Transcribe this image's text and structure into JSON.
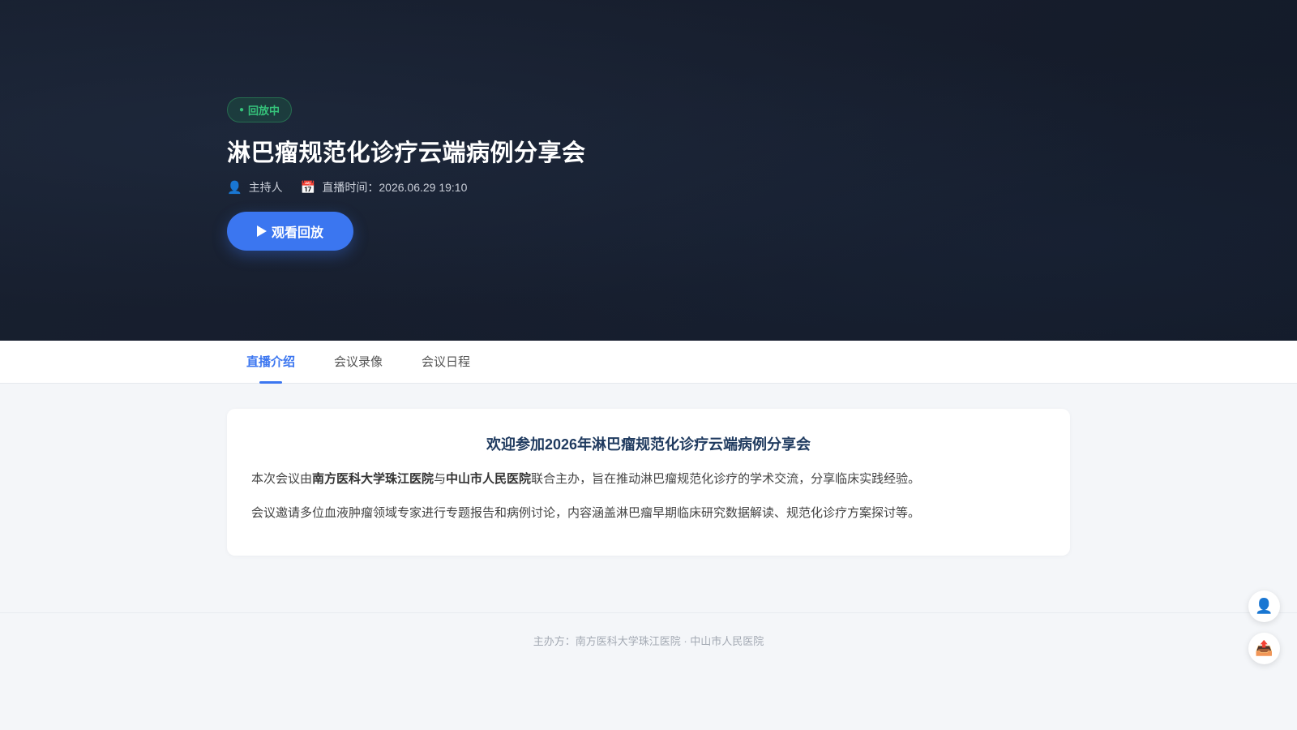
{
  "hero": {
    "status_badge": {
      "dot": "●",
      "label": "回放中"
    },
    "title": "淋巴瘤规范化诊疗云端病例分享会",
    "host": {
      "icon": "user-icon",
      "glyph": "👤",
      "label": "主持人"
    },
    "time": {
      "icon": "calendar-icon",
      "glyph": "📅",
      "label": "直播时间：",
      "value": "2026.06.29 19:10"
    },
    "watch_button": {
      "label": "观看回放",
      "icon": "play-icon"
    }
  },
  "tabs": [
    {
      "label": "直播介绍",
      "active": true
    },
    {
      "label": "会议录像",
      "active": false
    },
    {
      "label": "会议日程",
      "active": false
    }
  ],
  "intro": {
    "title": "欢迎参加2026年淋巴瘤规范化诊疗云端病例分享会",
    "p1": {
      "t1": "本次会议由",
      "org1": "南方医科大学珠江医院",
      "t2": "与",
      "org2": "中山市人民医院",
      "t3": "联合主办，旨在推动淋巴瘤规范化诊疗的学术交流，分享临床实践经验。"
    },
    "p2": "会议邀请多位血液肿瘤领域专家进行专题报告和病例讨论，内容涵盖淋巴瘤早期临床研究数据解读、规范化诊疗方案探讨等。"
  },
  "footer": {
    "text": "主办方：南方医科大学珠江医院 · 中山市人民医院"
  },
  "floating": {
    "user": {
      "icon": "user-icon",
      "glyph": "👤"
    },
    "share": {
      "icon": "share-icon",
      "glyph": "📤"
    }
  },
  "colors": {
    "accent": "#3b76f0",
    "status_green": "#35c27a",
    "hero_bg": "#171e2d",
    "intro_title": "#1f3a5f"
  }
}
